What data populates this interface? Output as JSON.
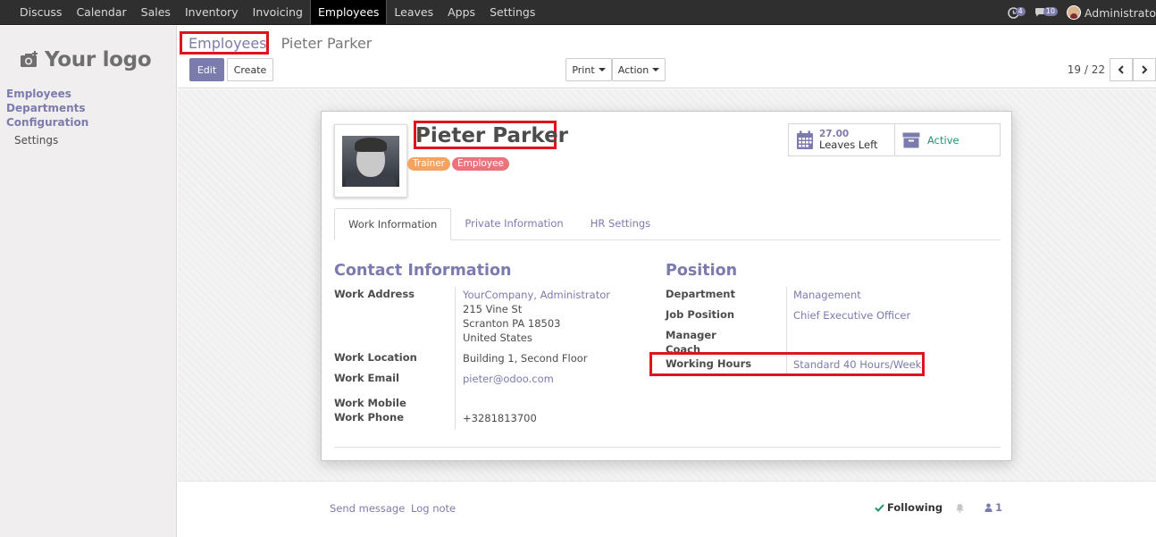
{
  "nav": {
    "items": [
      "Discuss",
      "Calendar",
      "Sales",
      "Inventory",
      "Invoicing",
      "Employees",
      "Leaves",
      "Apps",
      "Settings"
    ],
    "active": "Employees",
    "activity_count": "4",
    "message_count": "10",
    "user_name": "Administrato"
  },
  "sidebar": {
    "logo_text": "Your logo",
    "links": [
      "Employees",
      "Departments",
      "Configuration"
    ],
    "sub_item": "Settings"
  },
  "control": {
    "breadcrumb_parent": "Employees",
    "breadcrumb_current": "Pieter Parker",
    "edit_label": "Edit",
    "create_label": "Create",
    "print_label": "Print",
    "action_label": "Action",
    "pager": "19 / 22"
  },
  "employee": {
    "name": "Pieter Parker",
    "tags": [
      {
        "label": "Trainer",
        "color": "#f4a460"
      },
      {
        "label": "Employee",
        "color": "#e9747b"
      }
    ],
    "leaves_value": "27.00",
    "leaves_label": "Leaves Left",
    "active_label": "Active"
  },
  "tabs": [
    "Work Information",
    "Private Information",
    "HR Settings"
  ],
  "contact": {
    "title": "Contact Information",
    "work_address_label": "Work Address",
    "work_address_name": "YourCompany, Administrator",
    "work_address_line1": "215 Vine St",
    "work_address_line2": "Scranton PA 18503",
    "work_address_line3": "United States",
    "work_location_label": "Work Location",
    "work_location": "Building 1, Second Floor",
    "work_email_label": "Work Email",
    "work_email": "pieter@odoo.com",
    "work_mobile_label": "Work Mobile",
    "work_phone_label": "Work Phone",
    "work_phone": "+3281813700"
  },
  "position": {
    "title": "Position",
    "department_label": "Department",
    "department": "Management",
    "job_position_label": "Job Position",
    "job_position": "Chief Executive Officer",
    "manager_label": "Manager",
    "coach_label": "Coach",
    "working_hours_label": "Working Hours",
    "working_hours": "Standard 40 Hours/Week"
  },
  "chatter": {
    "send_message": "Send message",
    "log_note": "Log note",
    "following": "Following",
    "followers": "1"
  },
  "colors": {
    "accent": "#7c7bad",
    "highlight": "#e0121b",
    "active_green": "#21946a"
  }
}
